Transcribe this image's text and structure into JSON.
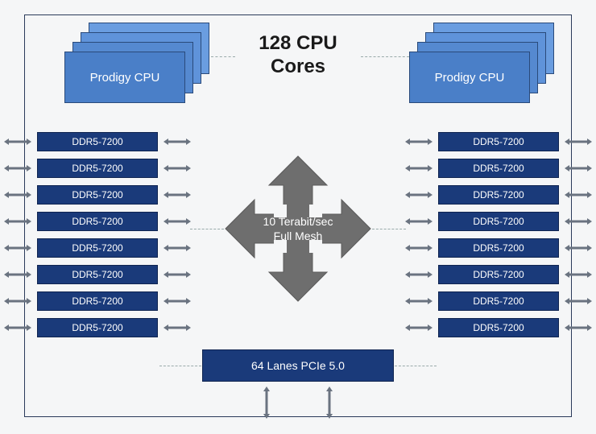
{
  "title_line1": "128 CPU",
  "title_line2": "Cores",
  "cpu_label_left": "Prodigy CPU",
  "cpu_label_right": "Prodigy CPU",
  "ddr_left": [
    "DDR5-7200",
    "DDR5-7200",
    "DDR5-7200",
    "DDR5-7200",
    "DDR5-7200",
    "DDR5-7200",
    "DDR5-7200",
    "DDR5-7200"
  ],
  "ddr_right": [
    "DDR5-7200",
    "DDR5-7200",
    "DDR5-7200",
    "DDR5-7200",
    "DDR5-7200",
    "DDR5-7200",
    "DDR5-7200",
    "DDR5-7200"
  ],
  "mesh_line1": "10 Terabit/sec",
  "mesh_line2": "Full Mesh",
  "pcie_label": "64 Lanes PCIe 5.0",
  "chart_data": {
    "type": "diagram",
    "title": "128 CPU Cores",
    "components": {
      "cpu_clusters": [
        {
          "name": "Prodigy CPU",
          "stacked_cards": 4,
          "position": "top-left"
        },
        {
          "name": "Prodigy CPU",
          "stacked_cards": 4,
          "position": "top-right"
        }
      ],
      "memory_channels": {
        "left": {
          "count": 8,
          "type": "DDR5-7200"
        },
        "right": {
          "count": 8,
          "type": "DDR5-7200"
        }
      },
      "interconnect": {
        "label": "10 Terabit/sec Full Mesh",
        "shape": "4-way-arrow"
      },
      "io": {
        "label": "64 Lanes PCIe 5.0",
        "position": "bottom"
      }
    },
    "connections": [
      "cpu-left <-> cpu-right (dashed)",
      "mesh <-> ddr-left (dashed)",
      "mesh <-> ddr-right (dashed)",
      "pcie <-> external (bidirectional x2)",
      "each ddr <-> external (bidirectional)",
      "each ddr <-> internal (bidirectional)"
    ]
  }
}
